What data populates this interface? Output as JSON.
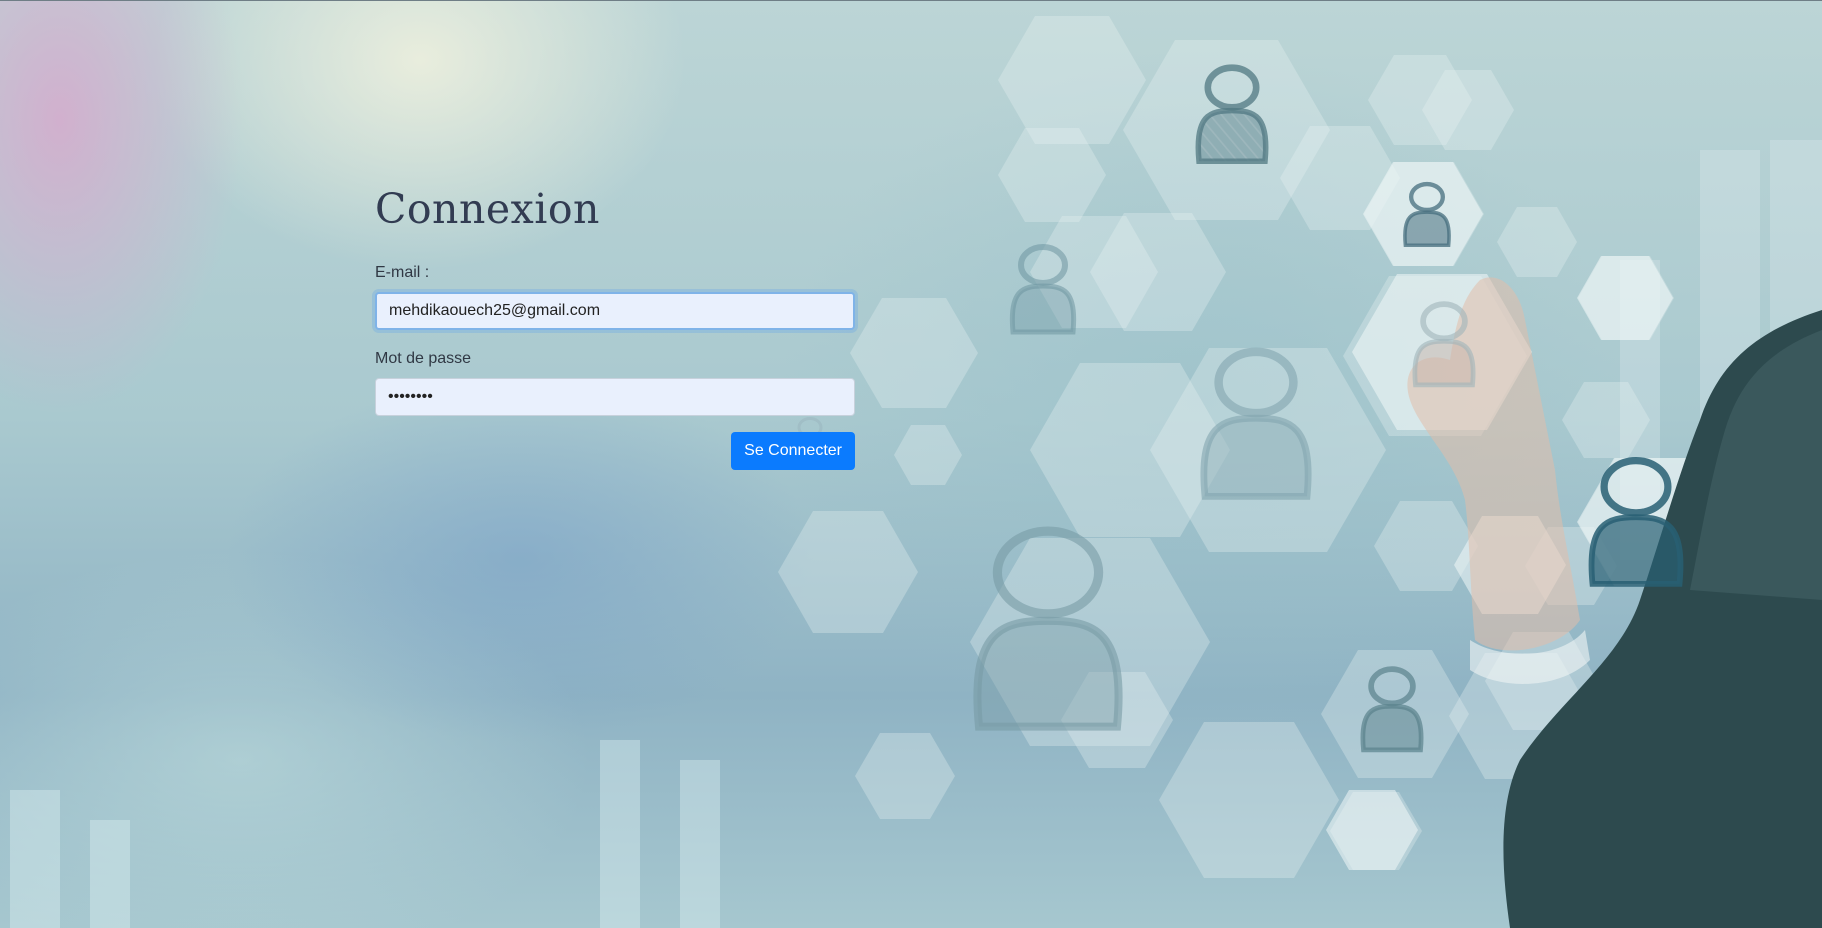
{
  "login": {
    "title": "Connexion",
    "email_label": "E-mail :",
    "email_value": "mehdikaouech25@gmail.com",
    "password_label": "Mot de passe",
    "password_value": "••••••••",
    "submit_label": "Se Connecter"
  },
  "colors": {
    "title": "#323c52",
    "button": "#0b7bfe",
    "input_background": "#e9f0fd"
  },
  "background": {
    "description_icons": [
      "hexagon-icon",
      "user-icon",
      "hand-icon"
    ]
  }
}
